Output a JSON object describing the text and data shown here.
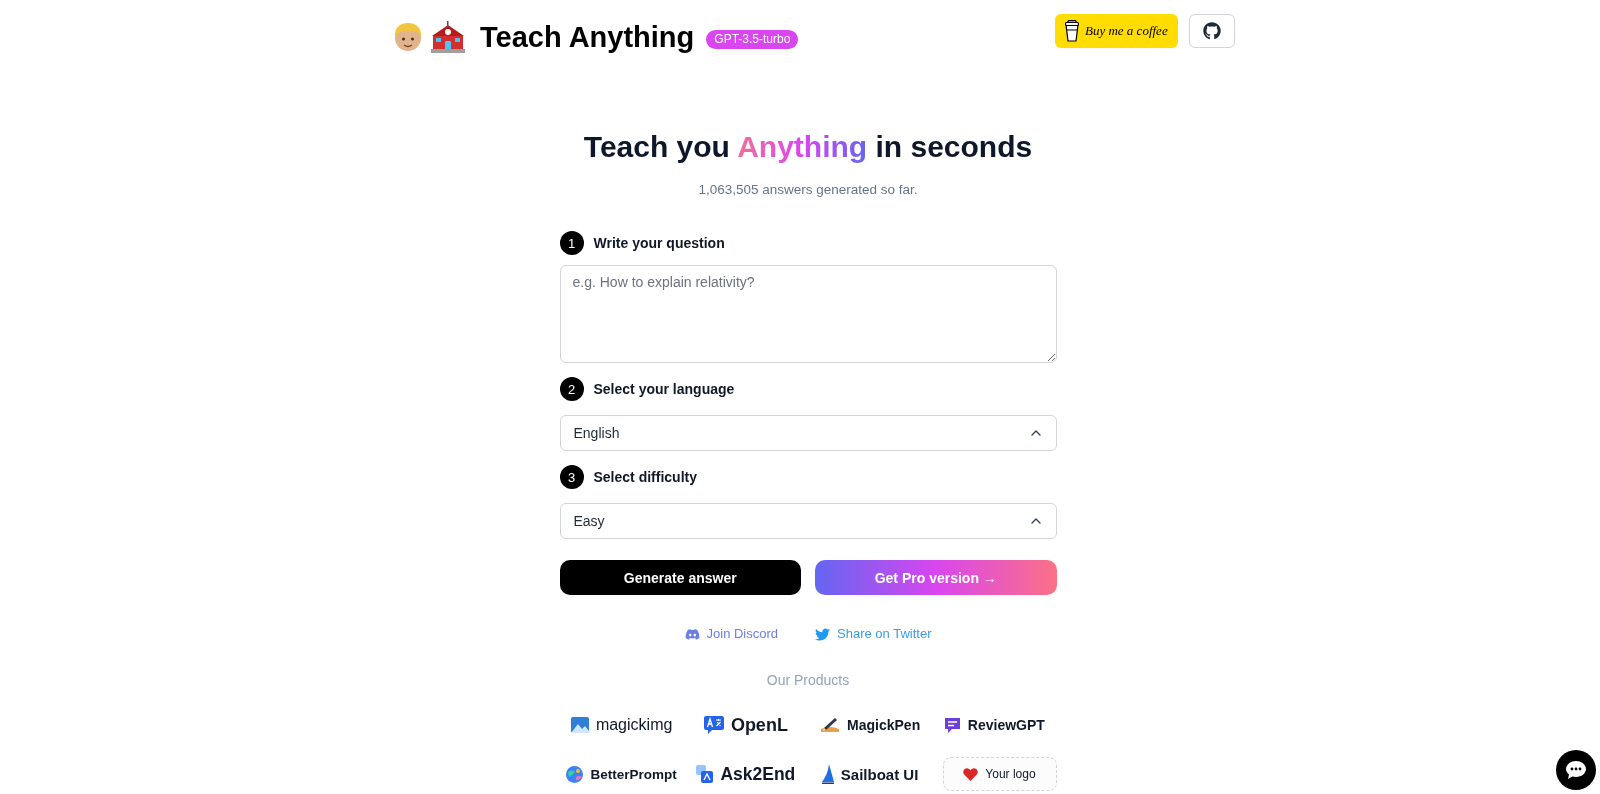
{
  "header": {
    "brand": "Teach Anything",
    "model_badge": "GPT-3.5-turbo",
    "coffee_button": "Buy me a coffee"
  },
  "hero": {
    "title": [
      {
        "text": "Teach you ",
        "kind": "plain"
      },
      {
        "text": "Anything",
        "kind": "gradient"
      },
      {
        "text": " in seconds",
        "kind": "plain"
      }
    ],
    "stats": "1,063,505 answers generated so far."
  },
  "steps": [
    {
      "number": "1",
      "label": "Write your question",
      "kind": "textarea",
      "placeholder": "e.g. How to explain relativity?"
    },
    {
      "number": "2",
      "label": "Select your language",
      "kind": "select",
      "value": "English"
    },
    {
      "number": "3",
      "label": "Select difficulty",
      "kind": "select",
      "value": "Easy"
    }
  ],
  "actions": [
    {
      "label": "Generate answer",
      "kind": "primary"
    },
    {
      "label": "Get Pro version →",
      "kind": "pro"
    }
  ],
  "social_links": [
    {
      "label": "Join Discord",
      "kind": "discord"
    },
    {
      "label": "Share on Twitter",
      "kind": "twitter"
    }
  ],
  "products": {
    "heading": "Our Products",
    "items": [
      {
        "name": "magickimg",
        "kind": "magickimg"
      },
      {
        "name": "OpenL",
        "kind": "openl"
      },
      {
        "name": "MagickPen",
        "kind": "magickpen"
      },
      {
        "name": "ReviewGPT",
        "kind": "reviewgpt"
      },
      {
        "name": "BetterPrompt",
        "kind": "betterprompt"
      },
      {
        "name": "Ask2End",
        "kind": "ask2end"
      },
      {
        "name": "Sailboat UI",
        "kind": "sailboat"
      },
      {
        "name": "Your logo",
        "kind": "placeholder"
      }
    ]
  }
}
